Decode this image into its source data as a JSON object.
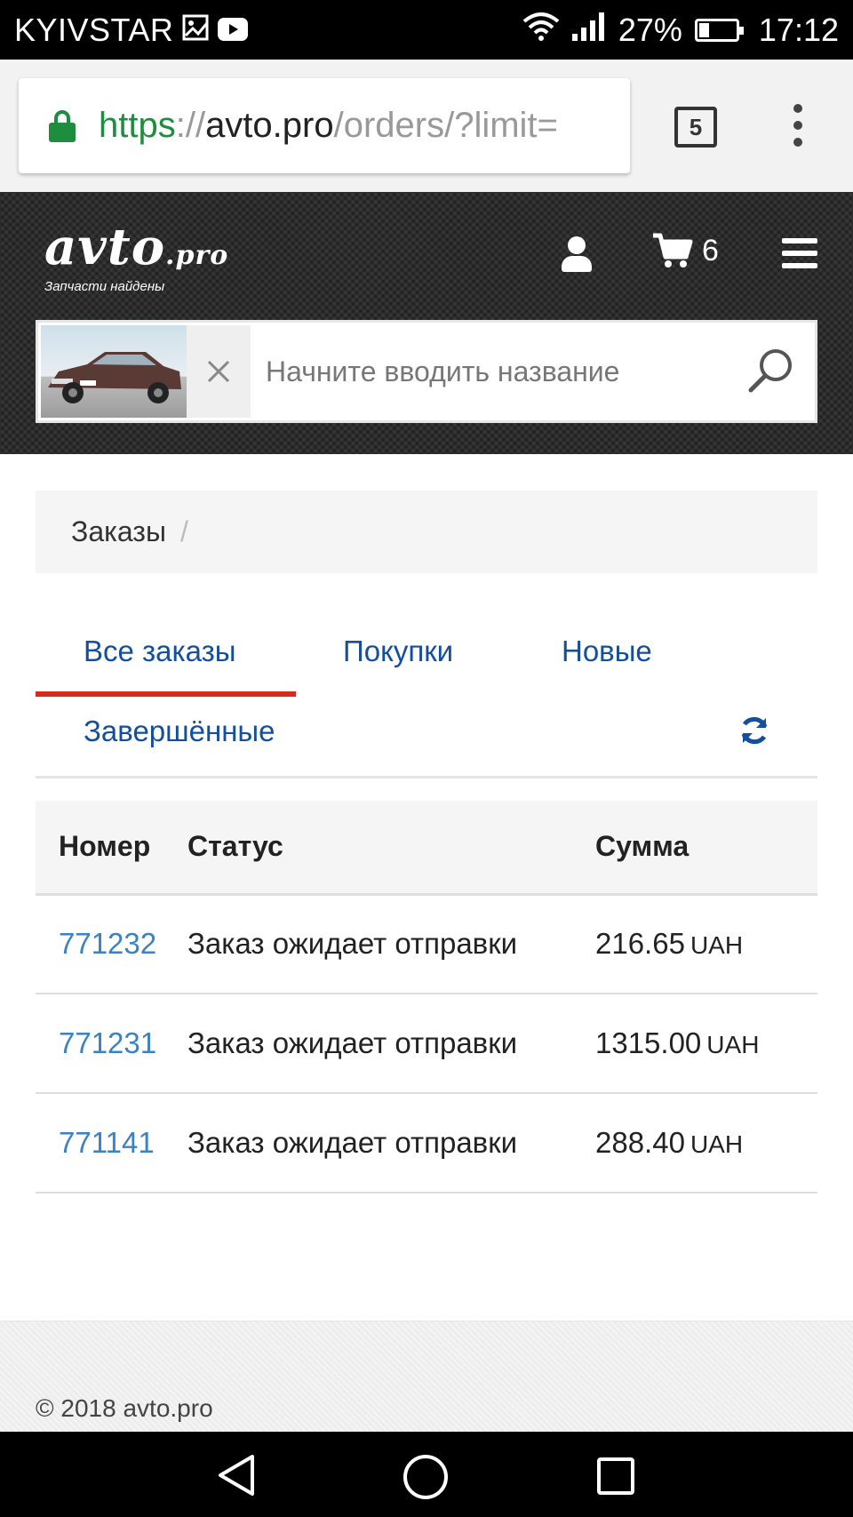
{
  "status_bar": {
    "carrier": "KYIVSTAR",
    "battery_text": "27%",
    "battery_level": 0.27,
    "time": "17:12"
  },
  "browser": {
    "url_scheme": "https",
    "url_sep": "://",
    "url_host": "avto.pro",
    "url_path": "/orders/?limit=",
    "tab_count": "5",
    "accent_color": "#1e8e3e"
  },
  "header": {
    "logo_main": "avto",
    "logo_suffix": ".pro",
    "logo_tagline": "Запчасти найдены",
    "cart_count": "6",
    "search_placeholder": "Начните вводить название"
  },
  "breadcrumb": {
    "current": "Заказы",
    "separator": "/"
  },
  "tabs": [
    {
      "label": "Все заказы",
      "active": true
    },
    {
      "label": "Покупки",
      "active": false
    },
    {
      "label": "Новые",
      "active": false
    },
    {
      "label": "Завершённые",
      "active": false
    }
  ],
  "table": {
    "headers": [
      "Номер",
      "Статус",
      "Сумма"
    ],
    "rows": [
      {
        "number": "771232",
        "status": "Заказ ожидает отправки",
        "amount": "216.65",
        "currency": "UAH"
      },
      {
        "number": "771231",
        "status": "Заказ ожидает отправки",
        "amount": "1315.00",
        "currency": "UAH"
      },
      {
        "number": "771141",
        "status": "Заказ ожидает отправки",
        "amount": "288.40",
        "currency": "UAH"
      }
    ]
  },
  "footer": {
    "copyright": "© 2018 avto.pro"
  },
  "colors": {
    "tab_active_underline": "#d52b1e",
    "link_blue": "#134f9c",
    "order_link": "#3b82c4"
  }
}
